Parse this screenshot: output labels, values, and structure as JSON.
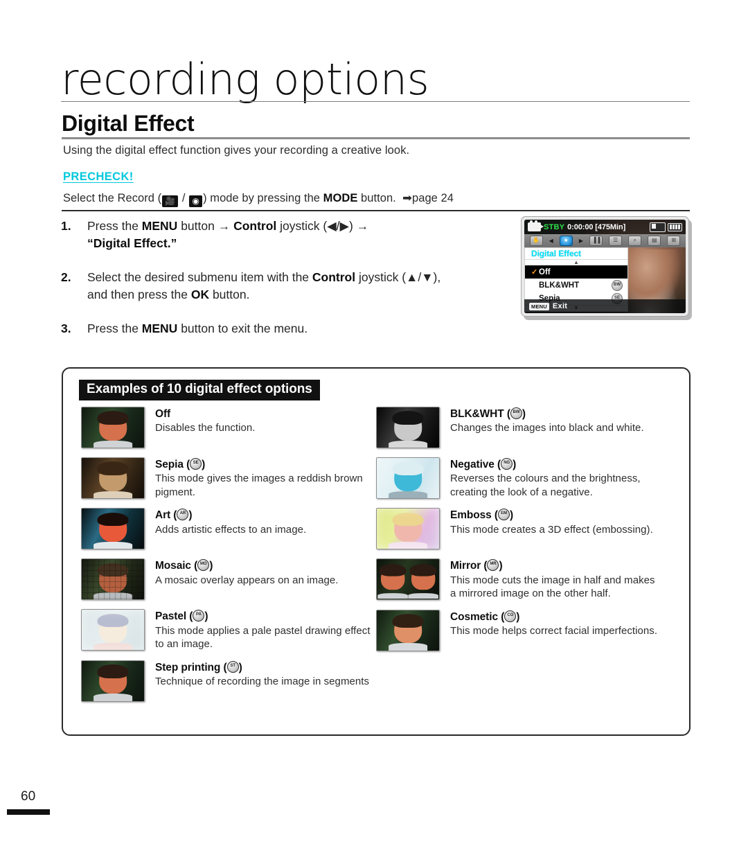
{
  "chapter": {
    "title": "recording options"
  },
  "section": {
    "title": "Digital Effect",
    "intro": "Using the digital effect function gives your recording a creative look."
  },
  "precheck": {
    "label": "PRECHECK!",
    "text_before": "Select the Record (",
    "icon_movie": "camcorder-icon",
    "separator": " / ",
    "icon_photo": "photo-camera-icon",
    "text_after": ") mode by pressing the ",
    "mode_button": "MODE",
    "text_end": " button.",
    "page_ref": "➡page 24"
  },
  "steps": [
    {
      "num": "1.",
      "parts": [
        {
          "t": "Press the ",
          "b": false
        },
        {
          "t": "MENU",
          "b": true
        },
        {
          "t": " button → ",
          "b": false
        },
        {
          "t": "Control",
          "b": true
        },
        {
          "t": " joystick (◀/▶) →",
          "b": false
        },
        {
          "t": "\n",
          "b": false
        },
        {
          "t": "“Digital Effect.”",
          "b": true
        }
      ]
    },
    {
      "num": "2.",
      "parts": [
        {
          "t": "Select the desired submenu item with the ",
          "b": false
        },
        {
          "t": "Control",
          "b": true
        },
        {
          "t": " joystick (▲/▼),",
          "b": false
        },
        {
          "t": "\n",
          "b": false
        },
        {
          "t": "and then press the ",
          "b": false
        },
        {
          "t": "OK",
          "b": true
        },
        {
          "t": " button.",
          "b": false
        }
      ]
    },
    {
      "num": "3.",
      "parts": [
        {
          "t": "Press the ",
          "b": false
        },
        {
          "t": "MENU",
          "b": true
        },
        {
          "t": " button to exit the menu.",
          "b": false
        }
      ]
    }
  ],
  "lcd": {
    "status": {
      "mode_icon": "camcorder-icon",
      "record_state": "STBY",
      "timecode": "0:00:00 [475Min]",
      "card_icon": "memory-card-icon",
      "battery_icon": "battery-full-icon"
    },
    "tabs": [
      {
        "name": "hand-shake-icon",
        "glyph": "✋",
        "active": false
      },
      {
        "name": "arrow-left-icon",
        "glyph": "◀",
        "active": false,
        "arrow": true
      },
      {
        "name": "digital-effect-icon",
        "glyph": "●",
        "active": true
      },
      {
        "name": "arrow-right-icon",
        "glyph": "▶",
        "active": false,
        "arrow": true
      },
      {
        "name": "exposure-icon",
        "glyph": "▐▐",
        "active": false
      },
      {
        "name": "scene-mode-icon",
        "glyph": "☰",
        "active": false
      },
      {
        "name": "zoom-icon",
        "glyph": "⌕",
        "active": false
      },
      {
        "name": "quality-icon",
        "glyph": "▤",
        "active": false
      },
      {
        "name": "display-icon",
        "glyph": "⊞",
        "active": false
      }
    ],
    "menu": {
      "title": "Digital Effect",
      "scroll_up": "▲",
      "scroll_down": "▼",
      "items": [
        {
          "label": "Off",
          "selected": true,
          "checked": true,
          "badge": ""
        },
        {
          "label": "BLK&WHT",
          "selected": false,
          "checked": false,
          "badge": "BW"
        },
        {
          "label": "Sepia",
          "selected": false,
          "checked": false,
          "badge": "SE"
        }
      ]
    },
    "footer": {
      "key": "MENU",
      "label": "Exit"
    }
  },
  "examples": {
    "heading": "Examples of 10 digital effect options",
    "left": [
      {
        "name": "Off",
        "badge": "",
        "desc": "Disables the function.",
        "thumb": "normal"
      },
      {
        "name": "Sepia",
        "badge": "SE",
        "desc": "This mode gives the images a reddish brown pigment.",
        "thumb": "sepia"
      },
      {
        "name": "Art",
        "badge": "AR",
        "desc": "Adds artistic effects to an image.",
        "thumb": "art"
      },
      {
        "name": "Mosaic",
        "badge": "MO",
        "desc": "A mosaic overlay appears on an image.",
        "thumb": "mosaic"
      },
      {
        "name": "Pastel",
        "badge": "PA",
        "desc": "This mode applies a pale pastel drawing effect to an image.",
        "thumb": "pastel"
      },
      {
        "name": "Step printing",
        "badge": "ST",
        "desc": "Technique of recording the image in segments",
        "thumb": "normal"
      }
    ],
    "right": [
      {
        "name": "BLK&WHT",
        "badge": "BW",
        "desc": "Changes the images into black and white.",
        "thumb": "bw"
      },
      {
        "name": "Negative",
        "badge": "NG",
        "desc": "Reverses the colours and the brightness, creating the look of a negative.",
        "thumb": "negative"
      },
      {
        "name": "Emboss",
        "badge": "EM",
        "desc": "This mode creates a 3D effect (embossing).",
        "thumb": "emboss"
      },
      {
        "name": "Mirror",
        "badge": "MR",
        "desc": "This mode cuts the image in half and makes a mirrored image on the other half.",
        "thumb": "mirror"
      },
      {
        "name": "Cosmetic",
        "badge": "CO",
        "desc": "This mode helps correct facial imperfections.",
        "thumb": "cosmetic"
      }
    ]
  },
  "footer": {
    "page_number": "60"
  },
  "colors": {
    "precheck": "#00c8dc",
    "menu_title": "#00e5ff",
    "stby": "#2ee24a",
    "check": "#ff9a1f"
  }
}
